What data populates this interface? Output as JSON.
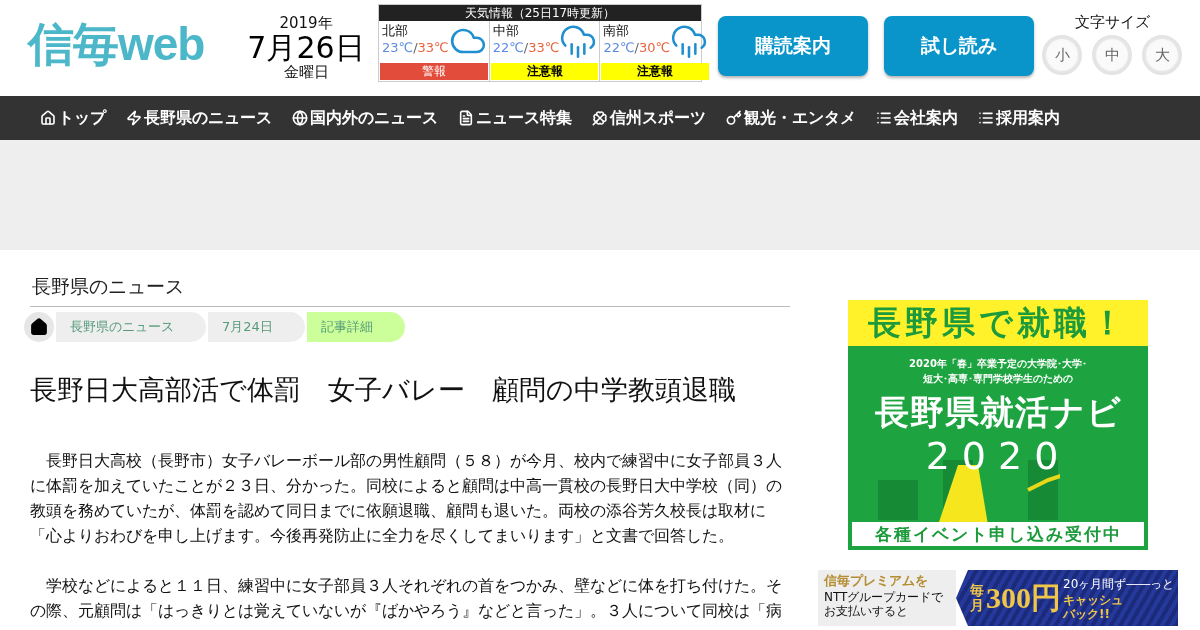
{
  "logo": "信毎web",
  "date": {
    "year": "2019年",
    "day": "7月26日",
    "weekday": "金曜日"
  },
  "weather": {
    "title": "天気情報（25日17時更新）",
    "regions": [
      {
        "name": "北部",
        "kind": "cloudy",
        "low": "23℃",
        "separator": "/",
        "high": "33℃",
        "alert": {
          "text": "警報",
          "color": "#e24c3b"
        }
      },
      {
        "name": "中部",
        "kind": "rainy",
        "low": "22℃",
        "separator": "/",
        "high": "33℃",
        "alert": {
          "text": "注意報",
          "color": "#ffff00"
        }
      },
      {
        "name": "南部",
        "kind": "rainy",
        "low": "22℃",
        "separator": "/",
        "high": "30℃",
        "alert": {
          "text": "注意報",
          "color": "#ffff00"
        }
      }
    ]
  },
  "buttons": [
    "購読案内",
    "試し読み"
  ],
  "font_size": {
    "label": "文字サイズ",
    "options": [
      "小",
      "中",
      "大"
    ]
  },
  "nav": [
    "トップ",
    "長野県のニュース",
    "国内外のニュース",
    "ニュース特集",
    "信州スポーツ",
    "観光・エンタメ",
    "会社案内",
    "採用案内"
  ],
  "section_title": "長野県のニュース",
  "breadcrumb": [
    {
      "label": "長野県のニュース",
      "selected": false
    },
    {
      "label": "7月24日",
      "selected": false
    },
    {
      "label": "記事詳細",
      "selected": true
    }
  ],
  "article": {
    "title": "長野日大高部活で体罰　女子バレー　顧問の中学教頭退職",
    "paragraphs": [
      "長野日大高校（長野市）女子バレーボール部の男性顧問（５８）が今月、校内で練習中に女子部員３人に体罰を加えていたことが２３日、分かった。同校によると顧問は中高一貫校の長野日大中学校（同）の教頭を務めていたが、体罰を認めて同日までに依願退職、顧問も退いた。両校の添谷芳久校長は取材に「心よりおわびを申し上げます。今後再発防止に全力を尽くしてまいります」と文書で回答した。",
      "学校などによると１１日、練習中に女子部員３人それぞれの首をつかみ、壁などに体を打ち付けた。その際、元顧問は「はっきりとは覚えていないが『ばかやろう』などと言った」。３人について同校は「病"
    ]
  },
  "job_ad": {
    "headline": "長野県で就職！",
    "lead": [
      "2020年「春」卒業予定の大学院･大学･",
      "短大･高専･専門学校学生のための"
    ],
    "title": "長野県就活ナビ",
    "year": "2020",
    "footer": "各種イベント申し込み受付中"
  },
  "premium_ad": {
    "brand": "信毎プレミアム",
    "particle": "を",
    "note": [
      "NTTグループカードで",
      "お支払いすると"
    ],
    "monthly": "毎月",
    "amount": "300円",
    "period": "20ヶ月間ず――っと",
    "cashback": "キャッシュバック!!"
  }
}
